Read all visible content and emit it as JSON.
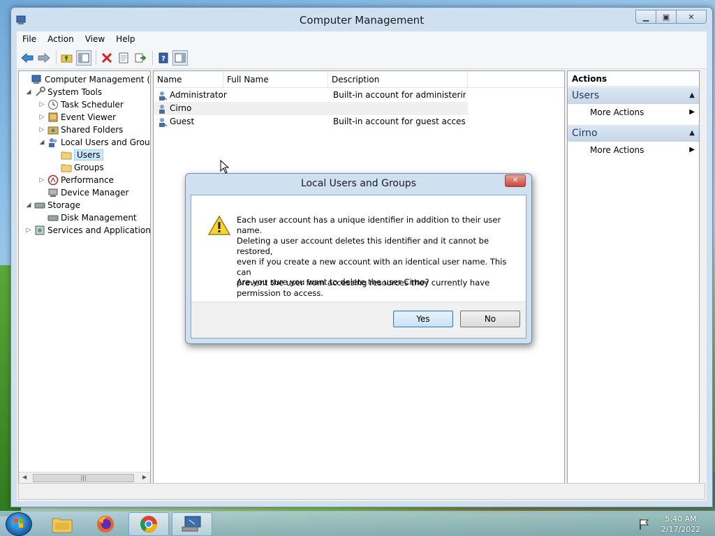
{
  "window": {
    "title": "Computer Management",
    "caption_buttons": [
      "minimize-icon",
      "maximize-icon",
      "close-icon"
    ]
  },
  "menu": [
    "File",
    "Action",
    "View",
    "Help"
  ],
  "toolbar_icons": [
    "back-arrow-icon",
    "forward-arrow-icon",
    "up-folder-icon",
    "show-hide-tree-icon",
    "delete-icon",
    "properties-icon",
    "export-list-icon",
    "help-icon",
    "show-hide-action-pane-icon"
  ],
  "tree": {
    "items": [
      {
        "label": "Computer Management (Local",
        "icon": "computer-management-icon",
        "expander": ""
      },
      {
        "label": "System Tools",
        "icon": "tools-icon",
        "expander": "expanded"
      },
      {
        "label": "Task Scheduler",
        "icon": "clock-icon",
        "expander": "collapsed"
      },
      {
        "label": "Event Viewer",
        "icon": "event-viewer-icon",
        "expander": "collapsed"
      },
      {
        "label": "Shared Folders",
        "icon": "shared-folder-icon",
        "expander": "collapsed"
      },
      {
        "label": "Local Users and Groups",
        "icon": "users-groups-icon",
        "expander": "expanded"
      },
      {
        "label": "Users",
        "icon": "folder-icon",
        "expander": "",
        "selected": true
      },
      {
        "label": "Groups",
        "icon": "folder-icon",
        "expander": ""
      },
      {
        "label": "Performance",
        "icon": "performance-icon",
        "expander": "collapsed"
      },
      {
        "label": "Device Manager",
        "icon": "device-manager-icon",
        "expander": ""
      },
      {
        "label": "Storage",
        "icon": "storage-icon",
        "expander": "expanded"
      },
      {
        "label": "Disk Management",
        "icon": "disk-icon",
        "expander": ""
      },
      {
        "label": "Services and Applications",
        "icon": "services-icon",
        "expander": "collapsed"
      }
    ]
  },
  "list": {
    "columns": [
      "Name",
      "Full Name",
      "Description"
    ],
    "rows": [
      {
        "name": "Administrator",
        "full_name": "",
        "description": "Built-in account for administering..."
      },
      {
        "name": "Cirno",
        "full_name": "",
        "description": ""
      },
      {
        "name": "Guest",
        "full_name": "",
        "description": "Built-in account for guest access t..."
      }
    ]
  },
  "actions": {
    "header": "Actions",
    "sections": [
      {
        "title": "Users",
        "item": "More Actions"
      },
      {
        "title": "Cirno",
        "item": "More Actions"
      }
    ]
  },
  "dialog": {
    "title": "Local Users and Groups",
    "message": "Each user account has a unique identifier in addition to their user name.\nDeleting a user account deletes this identifier and it cannot be restored,\neven if you create a new account with an identical user name. This can\nprevent the user from accessing resources they currently have\npermission to access.",
    "question": "Are you sure you want to delete the user Cirno?",
    "yes_label": "Yes",
    "no_label": "No",
    "icon": "warning-icon"
  },
  "taskbar": {
    "apps": [
      "file-explorer-icon",
      "firefox-icon",
      "chrome-icon",
      "computer-management-icon"
    ],
    "time": "5:40 AM",
    "date": "2/17/2022"
  }
}
